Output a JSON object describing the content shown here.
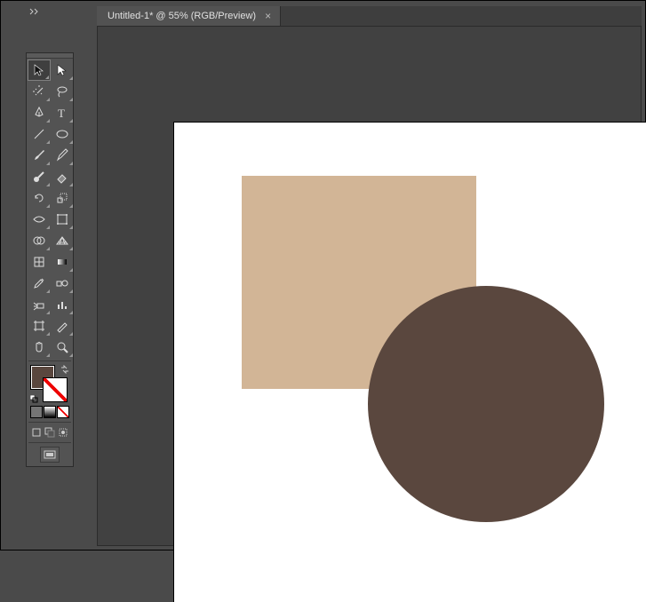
{
  "tab": {
    "title": "Untitled-1* @ 55% (RGB/Preview)",
    "close_glyph": "×"
  },
  "colors": {
    "fill": "#5a473e",
    "rect": "#d2b596",
    "circle": "#5a473e",
    "mini_solid": "#757575",
    "mini_gradient_a": "#fff",
    "mini_gradient_b": "#000"
  },
  "tools": {
    "row1": [
      "selection",
      "direct-selection"
    ],
    "row2": [
      "magic-wand",
      "lasso"
    ],
    "row3": [
      "pen",
      "type"
    ],
    "row4": [
      "line-segment",
      "ellipse-shape"
    ],
    "row5": [
      "paintbrush",
      "pencil"
    ],
    "row6": [
      "blob-brush",
      "eraser"
    ],
    "row7": [
      "rotate",
      "scale"
    ],
    "row8": [
      "width",
      "free-transform"
    ],
    "row9": [
      "shape-builder",
      "perspective-grid"
    ],
    "row10": [
      "mesh",
      "gradient"
    ],
    "row11": [
      "eyedropper",
      "blend"
    ],
    "row12": [
      "symbol-sprayer",
      "column-graph"
    ],
    "row13": [
      "artboard",
      "slice"
    ],
    "row14": [
      "hand",
      "zoom"
    ]
  }
}
